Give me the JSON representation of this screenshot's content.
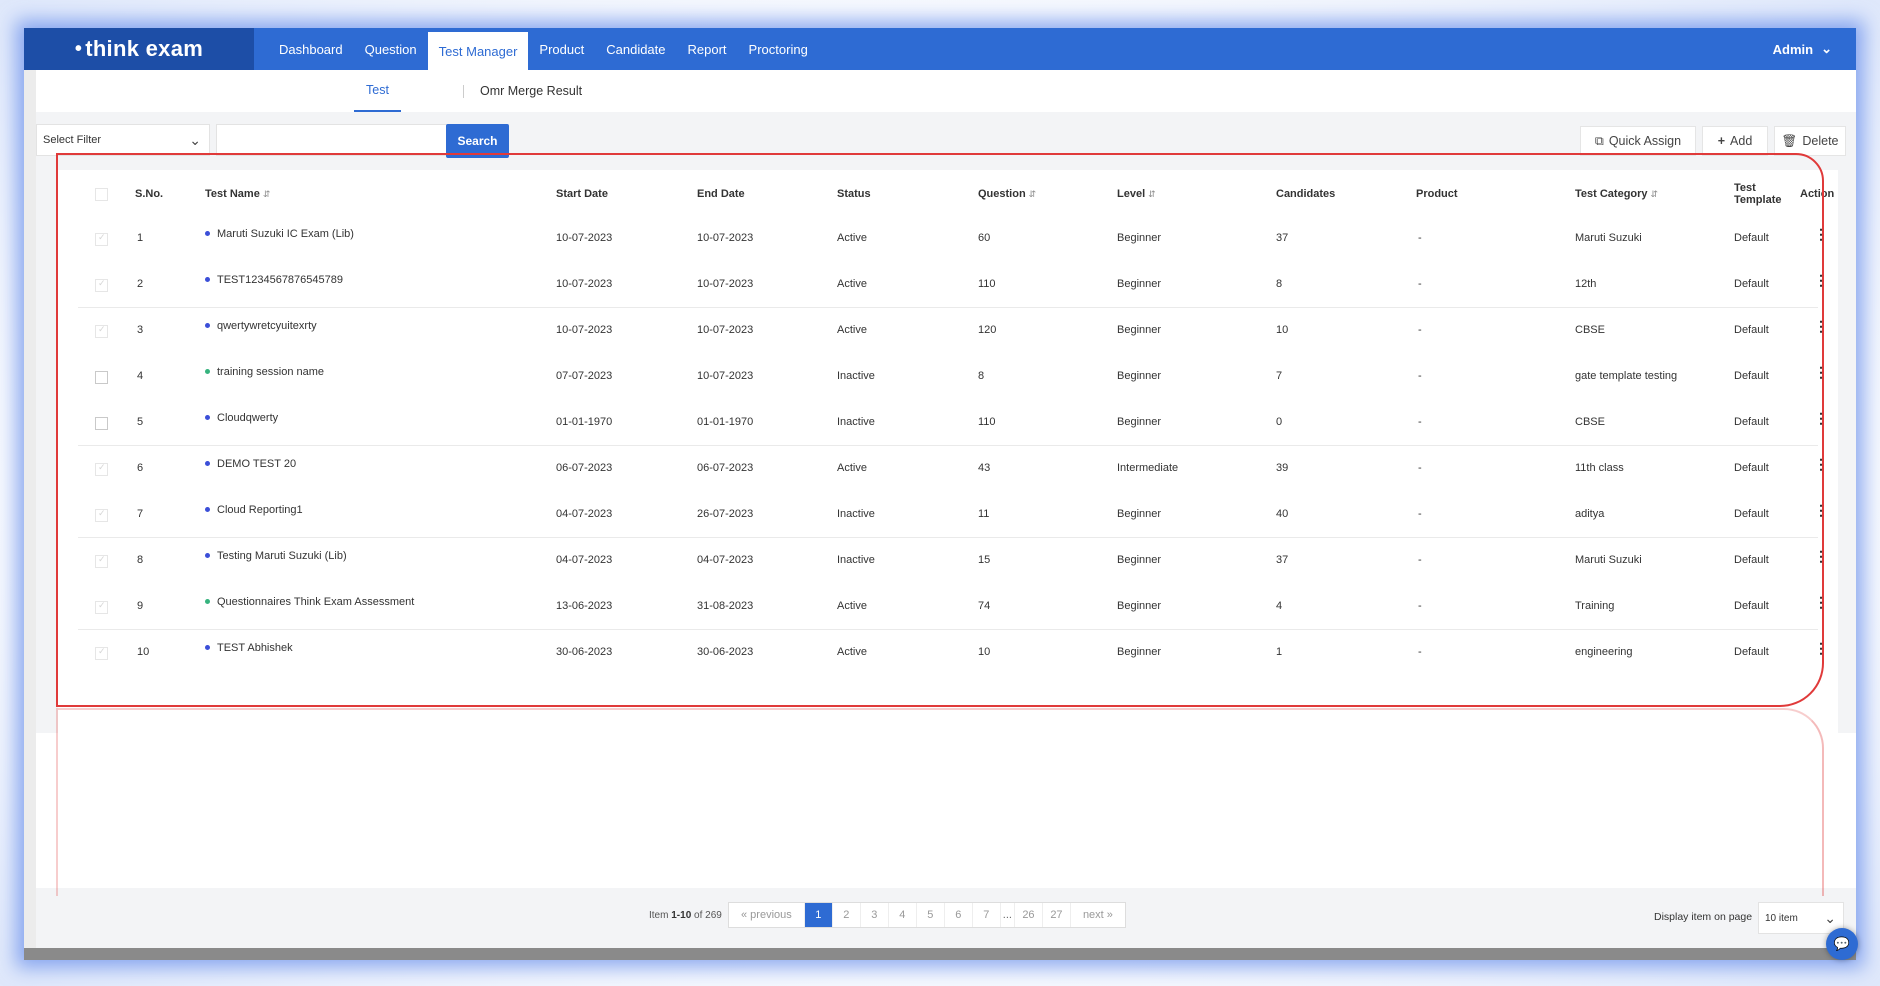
{
  "brand": {
    "logo_text": "think exam"
  },
  "nav": {
    "items": [
      {
        "label": "Dashboard"
      },
      {
        "label": "Question"
      },
      {
        "label": "Test Manager"
      },
      {
        "label": "Product"
      },
      {
        "label": "Candidate"
      },
      {
        "label": "Report"
      },
      {
        "label": "Proctoring"
      }
    ],
    "active": "Test Manager",
    "user": "Admin"
  },
  "subtabs": [
    {
      "label": "Test"
    },
    {
      "label": "Omr Merge Result"
    }
  ],
  "filter": {
    "select_placeholder": "Select Filter",
    "search_value": "",
    "search_button": "Search"
  },
  "toolbar": {
    "quick_assign": "Quick Assign",
    "add": "Add",
    "delete": "Delete"
  },
  "table": {
    "headers": {
      "sno": "S.No.",
      "name": "Test Name",
      "start": "Start Date",
      "end": "End Date",
      "status": "Status",
      "question": "Question",
      "level": "Level",
      "candidates": "Candidates",
      "product": "Product",
      "category": "Test Category",
      "template": "Test Template",
      "action": "Action"
    },
    "rows": [
      {
        "sno": "1",
        "name": "Maruti Suzuki IC Exam (Lib)",
        "start": "10-07-2023",
        "end": "10-07-2023",
        "status": "Active",
        "question": "60",
        "level": "Beginner",
        "candidates": "37",
        "product": "-",
        "category": "Maruti Suzuki",
        "template": "Default",
        "dot": "#3b4fd8"
      },
      {
        "sno": "2",
        "name": "TEST1234567876545789",
        "start": "10-07-2023",
        "end": "10-07-2023",
        "status": "Active",
        "question": "110",
        "level": "Beginner",
        "candidates": "8",
        "product": "-",
        "category": "12th",
        "template": "Default",
        "dot": "#3b4fd8"
      },
      {
        "sno": "3",
        "name": "qwertywretcyuitexrty",
        "start": "10-07-2023",
        "end": "10-07-2023",
        "status": "Active",
        "question": "120",
        "level": "Beginner",
        "candidates": "10",
        "product": "-",
        "category": "CBSE",
        "template": "Default",
        "dot": "#3b4fd8"
      },
      {
        "sno": "4",
        "name": "training session name",
        "start": "07-07-2023",
        "end": "10-07-2023",
        "status": "Inactive",
        "question": "8",
        "level": "Beginner",
        "candidates": "7",
        "product": "-",
        "category": "gate template testing",
        "template": "Default",
        "dot": "#36b37e"
      },
      {
        "sno": "5",
        "name": "Cloudqwerty",
        "start": "01-01-1970",
        "end": "01-01-1970",
        "status": "Inactive",
        "question": "110",
        "level": "Beginner",
        "candidates": "0",
        "product": "-",
        "category": "CBSE",
        "template": "Default",
        "dot": "#3b4fd8"
      },
      {
        "sno": "6",
        "name": "DEMO TEST 20",
        "start": "06-07-2023",
        "end": "06-07-2023",
        "status": "Active",
        "question": "43",
        "level": "Intermediate",
        "candidates": "39",
        "product": "-",
        "category": "11th class",
        "template": "Default",
        "dot": "#3b4fd8"
      },
      {
        "sno": "7",
        "name": "Cloud Reporting1",
        "start": "04-07-2023",
        "end": "26-07-2023",
        "status": "Inactive",
        "question": "11",
        "level": "Beginner",
        "candidates": "40",
        "product": "-",
        "category": "aditya",
        "template": "Default",
        "dot": "#3b4fd8"
      },
      {
        "sno": "8",
        "name": "Testing Maruti Suzuki (Lib)",
        "start": "04-07-2023",
        "end": "04-07-2023",
        "status": "Inactive",
        "question": "15",
        "level": "Beginner",
        "candidates": "37",
        "product": "-",
        "category": "Maruti Suzuki",
        "template": "Default",
        "dot": "#3b4fd8"
      },
      {
        "sno": "9",
        "name": "Questionnaires Think Exam Assessment",
        "start": "13-06-2023",
        "end": "31-08-2023",
        "status": "Active",
        "question": "74",
        "level": "Beginner",
        "candidates": "4",
        "product": "-",
        "category": "Training",
        "template": "Default",
        "dot": "#36b37e"
      },
      {
        "sno": "10",
        "name": "TEST Abhishek",
        "start": "30-06-2023",
        "end": "30-06-2023",
        "status": "Active",
        "question": "10",
        "level": "Beginner",
        "candidates": "1",
        "product": "-",
        "category": "engineering",
        "template": "Default",
        "dot": "#3b4fd8"
      }
    ]
  },
  "pagination": {
    "info_prefix": "Item",
    "info_range": "1-10",
    "info_suffix": "of 269",
    "prev": "« previous",
    "pages": [
      "1",
      "2",
      "3",
      "4",
      "5",
      "6",
      "7",
      "...",
      "26",
      "27"
    ],
    "active_page": "1",
    "next": "next »",
    "display_label": "Display item on page",
    "display_value": "10 item"
  },
  "colors": {
    "primary": "#2e6bd3",
    "brand_dark": "#1d4ea7",
    "highlight": "#e03a3a"
  }
}
